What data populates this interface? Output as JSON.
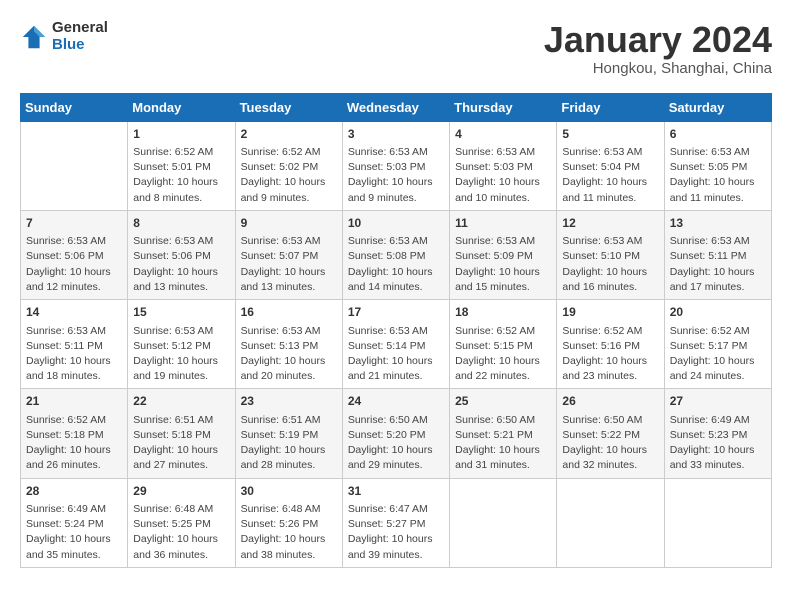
{
  "header": {
    "logo_general": "General",
    "logo_blue": "Blue",
    "title": "January 2024",
    "location": "Hongkou, Shanghai, China"
  },
  "days_of_week": [
    "Sunday",
    "Monday",
    "Tuesday",
    "Wednesday",
    "Thursday",
    "Friday",
    "Saturday"
  ],
  "weeks": [
    [
      {
        "day": null
      },
      {
        "day": "1",
        "sunrise": "6:52 AM",
        "sunset": "5:01 PM",
        "daylight": "10 hours and 8 minutes."
      },
      {
        "day": "2",
        "sunrise": "6:52 AM",
        "sunset": "5:02 PM",
        "daylight": "10 hours and 9 minutes."
      },
      {
        "day": "3",
        "sunrise": "6:53 AM",
        "sunset": "5:03 PM",
        "daylight": "10 hours and 9 minutes."
      },
      {
        "day": "4",
        "sunrise": "6:53 AM",
        "sunset": "5:03 PM",
        "daylight": "10 hours and 10 minutes."
      },
      {
        "day": "5",
        "sunrise": "6:53 AM",
        "sunset": "5:04 PM",
        "daylight": "10 hours and 11 minutes."
      },
      {
        "day": "6",
        "sunrise": "6:53 AM",
        "sunset": "5:05 PM",
        "daylight": "10 hours and 11 minutes."
      }
    ],
    [
      {
        "day": "7",
        "sunrise": "6:53 AM",
        "sunset": "5:06 PM",
        "daylight": "10 hours and 12 minutes."
      },
      {
        "day": "8",
        "sunrise": "6:53 AM",
        "sunset": "5:06 PM",
        "daylight": "10 hours and 13 minutes."
      },
      {
        "day": "9",
        "sunrise": "6:53 AM",
        "sunset": "5:07 PM",
        "daylight": "10 hours and 13 minutes."
      },
      {
        "day": "10",
        "sunrise": "6:53 AM",
        "sunset": "5:08 PM",
        "daylight": "10 hours and 14 minutes."
      },
      {
        "day": "11",
        "sunrise": "6:53 AM",
        "sunset": "5:09 PM",
        "daylight": "10 hours and 15 minutes."
      },
      {
        "day": "12",
        "sunrise": "6:53 AM",
        "sunset": "5:10 PM",
        "daylight": "10 hours and 16 minutes."
      },
      {
        "day": "13",
        "sunrise": "6:53 AM",
        "sunset": "5:11 PM",
        "daylight": "10 hours and 17 minutes."
      }
    ],
    [
      {
        "day": "14",
        "sunrise": "6:53 AM",
        "sunset": "5:11 PM",
        "daylight": "10 hours and 18 minutes."
      },
      {
        "day": "15",
        "sunrise": "6:53 AM",
        "sunset": "5:12 PM",
        "daylight": "10 hours and 19 minutes."
      },
      {
        "day": "16",
        "sunrise": "6:53 AM",
        "sunset": "5:13 PM",
        "daylight": "10 hours and 20 minutes."
      },
      {
        "day": "17",
        "sunrise": "6:53 AM",
        "sunset": "5:14 PM",
        "daylight": "10 hours and 21 minutes."
      },
      {
        "day": "18",
        "sunrise": "6:52 AM",
        "sunset": "5:15 PM",
        "daylight": "10 hours and 22 minutes."
      },
      {
        "day": "19",
        "sunrise": "6:52 AM",
        "sunset": "5:16 PM",
        "daylight": "10 hours and 23 minutes."
      },
      {
        "day": "20",
        "sunrise": "6:52 AM",
        "sunset": "5:17 PM",
        "daylight": "10 hours and 24 minutes."
      }
    ],
    [
      {
        "day": "21",
        "sunrise": "6:52 AM",
        "sunset": "5:18 PM",
        "daylight": "10 hours and 26 minutes."
      },
      {
        "day": "22",
        "sunrise": "6:51 AM",
        "sunset": "5:18 PM",
        "daylight": "10 hours and 27 minutes."
      },
      {
        "day": "23",
        "sunrise": "6:51 AM",
        "sunset": "5:19 PM",
        "daylight": "10 hours and 28 minutes."
      },
      {
        "day": "24",
        "sunrise": "6:50 AM",
        "sunset": "5:20 PM",
        "daylight": "10 hours and 29 minutes."
      },
      {
        "day": "25",
        "sunrise": "6:50 AM",
        "sunset": "5:21 PM",
        "daylight": "10 hours and 31 minutes."
      },
      {
        "day": "26",
        "sunrise": "6:50 AM",
        "sunset": "5:22 PM",
        "daylight": "10 hours and 32 minutes."
      },
      {
        "day": "27",
        "sunrise": "6:49 AM",
        "sunset": "5:23 PM",
        "daylight": "10 hours and 33 minutes."
      }
    ],
    [
      {
        "day": "28",
        "sunrise": "6:49 AM",
        "sunset": "5:24 PM",
        "daylight": "10 hours and 35 minutes."
      },
      {
        "day": "29",
        "sunrise": "6:48 AM",
        "sunset": "5:25 PM",
        "daylight": "10 hours and 36 minutes."
      },
      {
        "day": "30",
        "sunrise": "6:48 AM",
        "sunset": "5:26 PM",
        "daylight": "10 hours and 38 minutes."
      },
      {
        "day": "31",
        "sunrise": "6:47 AM",
        "sunset": "5:27 PM",
        "daylight": "10 hours and 39 minutes."
      },
      {
        "day": null
      },
      {
        "day": null
      },
      {
        "day": null
      }
    ]
  ],
  "labels": {
    "sunrise": "Sunrise:",
    "sunset": "Sunset:",
    "daylight": "Daylight:"
  }
}
